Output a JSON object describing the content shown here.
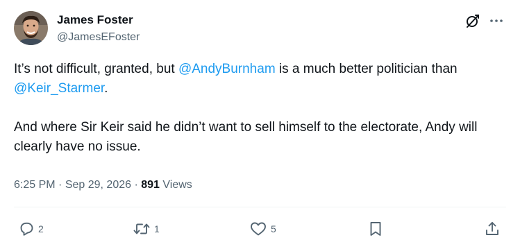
{
  "author": {
    "display_name": "James Foster",
    "handle": "@JamesEFoster",
    "avatar_icon": "avatar-photo"
  },
  "header_icons": {
    "grok": "grok-icon",
    "more": "more-icon"
  },
  "tweet": {
    "line1_pre": "It’s not difficult, granted, but ",
    "mention1": "@AndyBurnham",
    "line1_post": " is a much better politician than ",
    "mention2": "@Keir_Starmer",
    "line1_end": ".",
    "paragraph2": "And where Sir Keir said he didn’t want to sell himself to the electorate, Andy will clearly have no issue."
  },
  "meta": {
    "time": "6:25 PM",
    "separator": " · ",
    "date": "Sep 29, 2026",
    "views_count": "891",
    "views_label": "Views"
  },
  "actions": {
    "reply_count": "2",
    "repost_count": "1",
    "like_count": "5"
  },
  "colors": {
    "text": "#0f1419",
    "secondary": "#536471",
    "link": "#1d9bf0",
    "divider": "#eff3f4"
  }
}
